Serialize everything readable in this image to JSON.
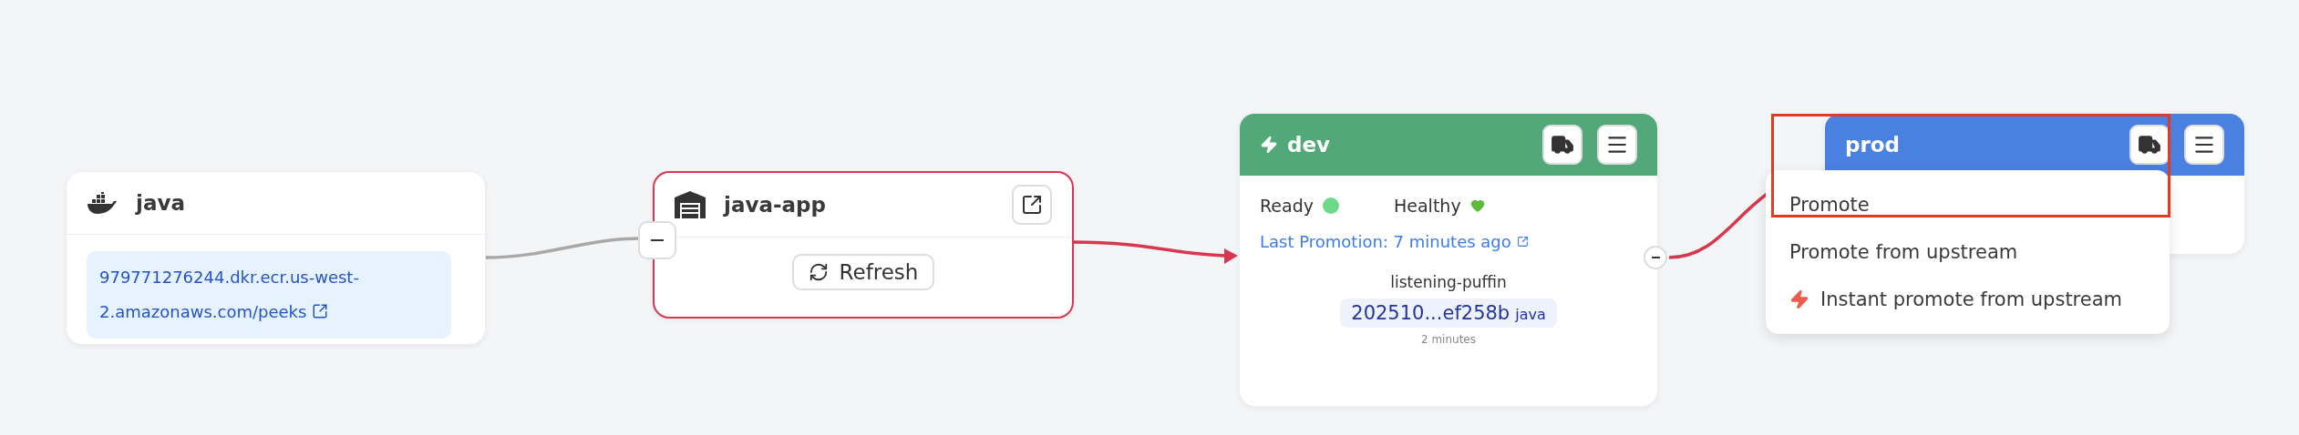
{
  "nodes": [
    {
      "kind": "image",
      "title": "java",
      "link": "979771276244.dkr.ecr.us-west-2.amazonaws.com/peeks",
      "highlighted": false
    },
    {
      "kind": "warehouse",
      "title": "java-app",
      "button": "Refresh",
      "highlighted": true
    },
    {
      "kind": "stage",
      "title": "dev",
      "color": "#52a878",
      "auto_promote": true,
      "ready": "Ready",
      "healthy": "Healthy",
      "promotion": "Last Promotion: 7 minutes ago",
      "freight_name": "listening-puffin",
      "freight_id": "202510...ef258b",
      "freight_tag": "java",
      "freight_age": "2 minutes"
    },
    {
      "kind": "stage",
      "title": "prod",
      "color": "#4a80e0",
      "auto_promote": false
    }
  ],
  "edges": [
    {
      "color": "#a8a8a8",
      "arrow": false
    },
    {
      "color": "#d8384f",
      "arrow": true
    },
    {
      "color": "#d8384f",
      "arrow": false
    }
  ],
  "menu": {
    "items": [
      {
        "label": "Promote",
        "instant": false
      },
      {
        "label": "Promote from upstream",
        "instant": false
      },
      {
        "label": "Instant promote from upstream",
        "instant": true
      }
    ]
  },
  "annotation": {
    "kind": "box"
  }
}
